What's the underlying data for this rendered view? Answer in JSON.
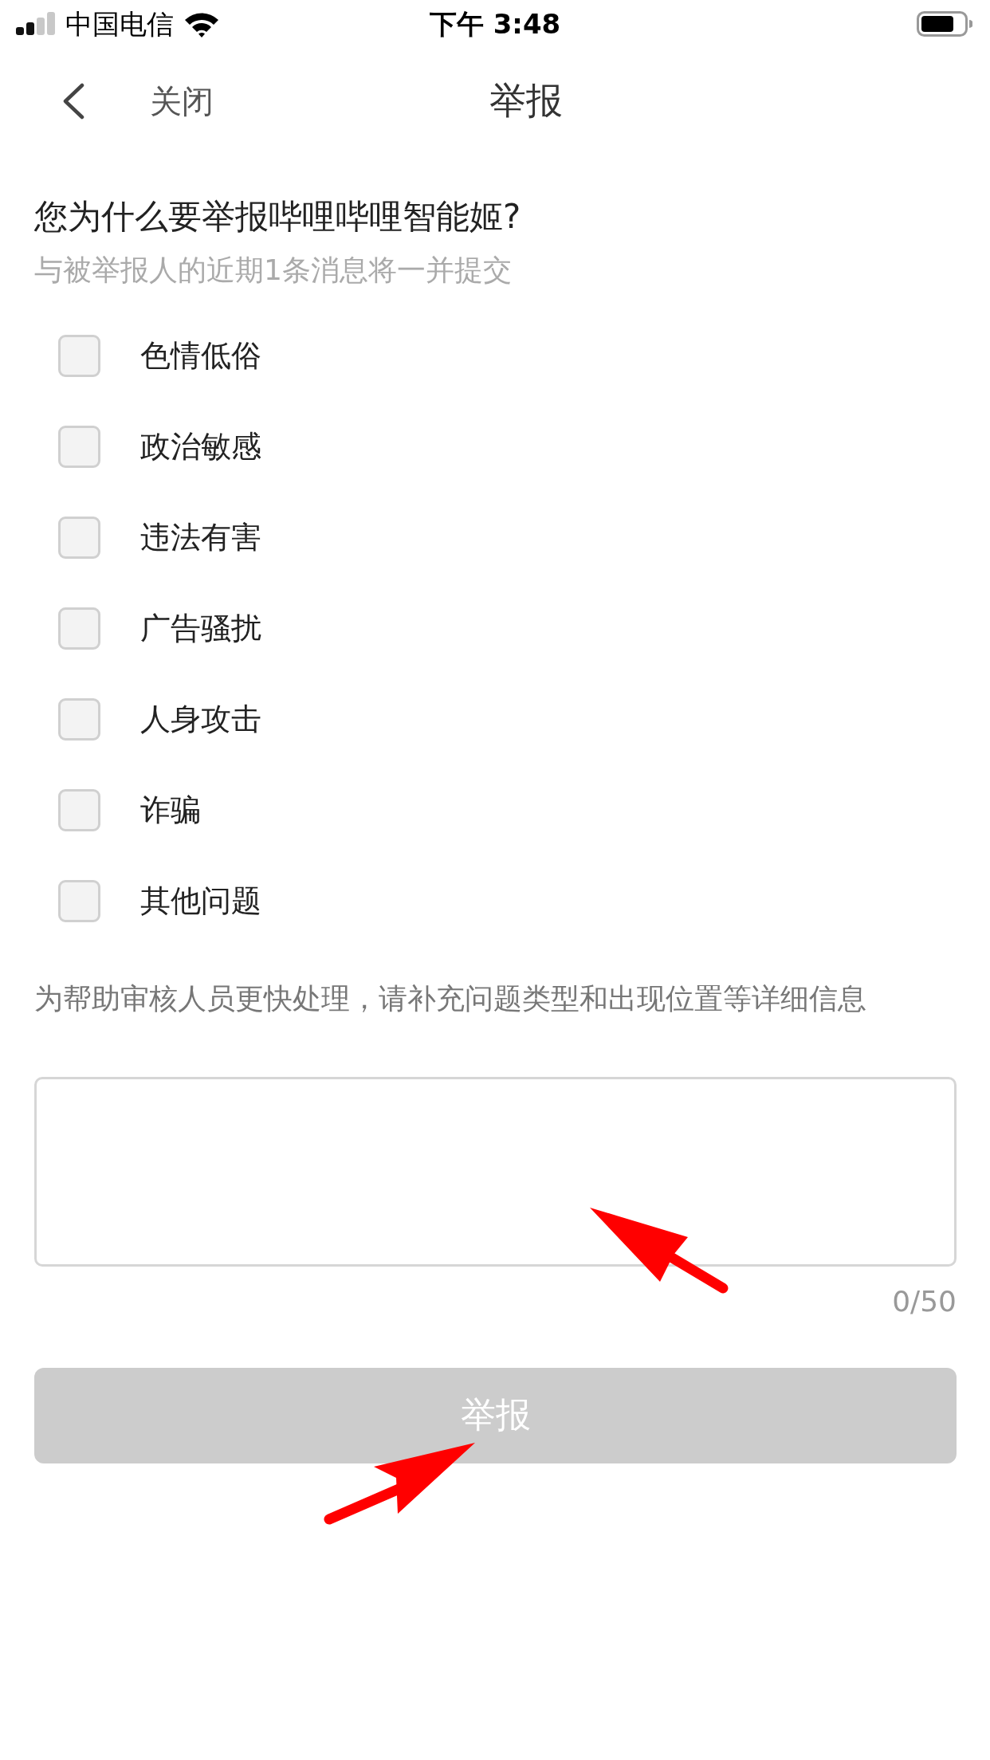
{
  "status_bar": {
    "carrier": "中国电信",
    "time": "下午 3:48"
  },
  "nav_bar": {
    "close_label": "关闭",
    "title": "举报"
  },
  "question": "您为什么要举报哔哩哔哩智能姬?",
  "note": "与被举报人的近期1条消息将一并提交",
  "reasons": [
    {
      "label": "色情低俗",
      "checked": false
    },
    {
      "label": "政治敏感",
      "checked": false
    },
    {
      "label": "违法有害",
      "checked": false
    },
    {
      "label": "广告骚扰",
      "checked": false
    },
    {
      "label": "人身攻击",
      "checked": false
    },
    {
      "label": "诈骗",
      "checked": false
    },
    {
      "label": "其他问题",
      "checked": false
    }
  ],
  "details": {
    "hint": "为帮助审核人员更快处理，请补充问题类型和出现位置等详细信息",
    "counter": "0/50"
  },
  "submit": {
    "label": "举报",
    "disabled": true
  }
}
